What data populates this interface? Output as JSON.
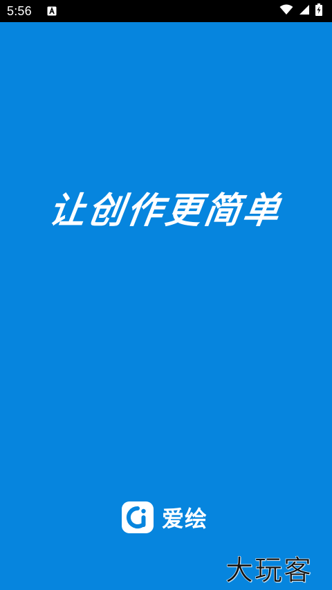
{
  "status_bar": {
    "time": "5:56",
    "notification_icon": "a-text-notification-icon",
    "wifi_icon": "wifi-icon",
    "signal_icon": "cell-signal-icon",
    "battery_icon": "battery-charging-icon"
  },
  "splash": {
    "slogan": "让创作更简单",
    "background_color": "#0685DE"
  },
  "brand": {
    "logo_icon": "aihui-logo-icon",
    "name": "爱绘"
  },
  "watermark": {
    "text": "大玩客"
  }
}
